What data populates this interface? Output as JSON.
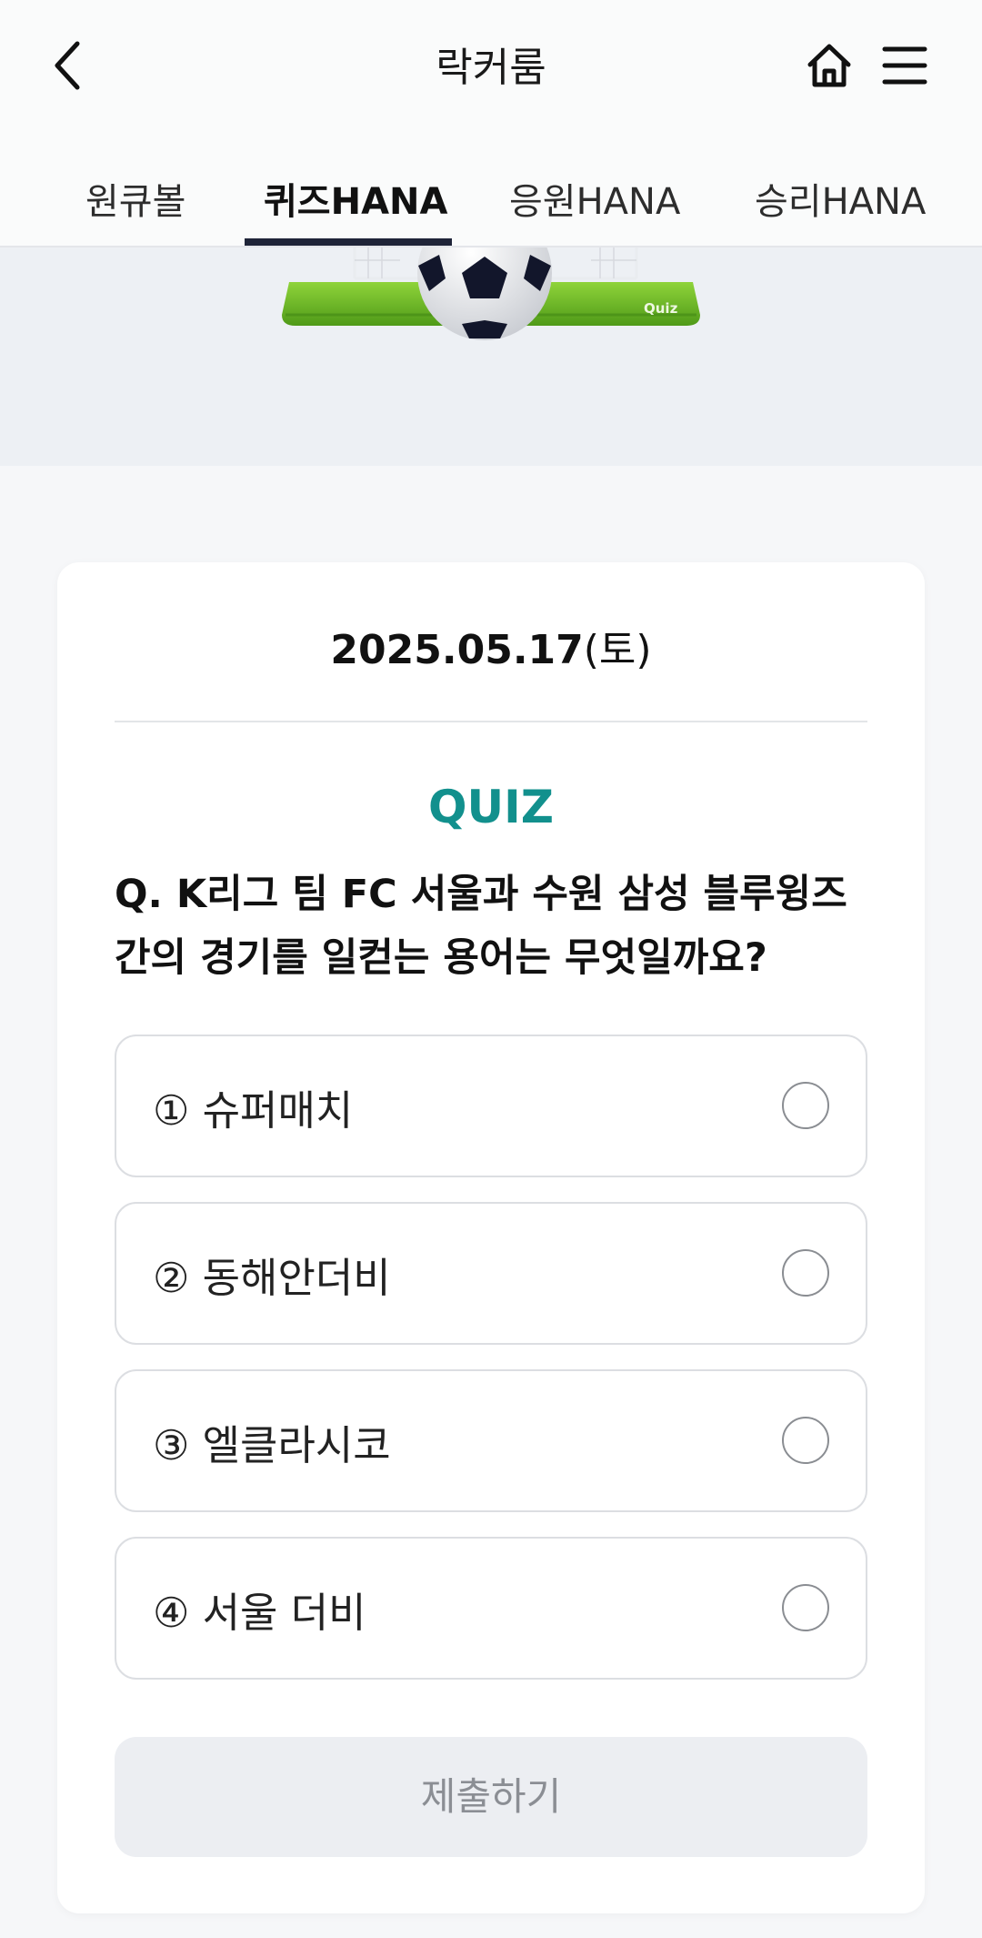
{
  "header": {
    "title": "락커룸",
    "back_icon": "chevron-left-icon",
    "home_icon": "home-icon",
    "menu_icon": "hamburger-menu-icon"
  },
  "tabs": [
    {
      "label": "원큐볼",
      "active": false
    },
    {
      "label": "퀴즈HANA",
      "active": true
    },
    {
      "label": "응원HANA",
      "active": false
    },
    {
      "label": "승리HANA",
      "active": false
    }
  ],
  "banner": {
    "goal_label": "Quiz"
  },
  "quiz": {
    "date": "2025.05.17",
    "day_of_week": "(토)",
    "label": "QUIZ",
    "question_line1": "Q. K리그 팀 FC 서울과 수원 삼성 블루윙즈",
    "question_line2": "간의 경기를 일컫는 용어는 무엇일까요?",
    "options": [
      {
        "label": "① 슈퍼매치"
      },
      {
        "label": "② 동해안더비"
      },
      {
        "label": "③ 엘클라시코"
      },
      {
        "label": "④ 서울 더비"
      }
    ],
    "submit_label": "제출하기"
  },
  "colors": {
    "accent": "#12908d",
    "tab_indicator": "#1f2438",
    "submit_disabled_bg": "#eceef2",
    "submit_disabled_text": "#8b8e94"
  }
}
